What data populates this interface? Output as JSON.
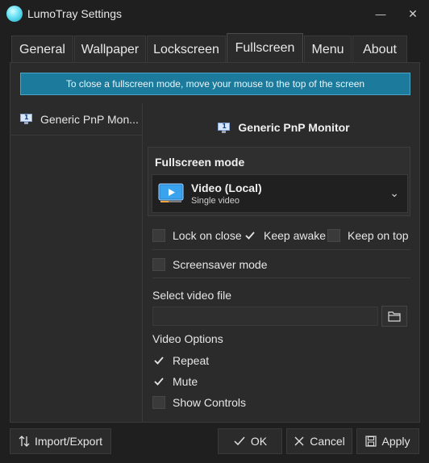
{
  "window": {
    "title": "LumoTray Settings",
    "minimize_glyph": "—",
    "close_glyph": "✕"
  },
  "tabs": [
    {
      "label": "General",
      "active": false
    },
    {
      "label": "Wallpaper",
      "active": false
    },
    {
      "label": "Lockscreen",
      "active": false
    },
    {
      "label": "Fullscreen",
      "active": true
    },
    {
      "label": "Menu",
      "active": false
    },
    {
      "label": "About",
      "active": false
    }
  ],
  "banner": {
    "text": "To close a fullscreen mode, move your mouse to the top of the screen",
    "color": "#1c7b9c"
  },
  "monitors": {
    "list_item": "Generic PnP Mon...",
    "icon_number": "1",
    "selected_header": "Generic PnP Monitor"
  },
  "fullscreen_mode": {
    "title": "Fullscreen mode",
    "selected_name": "Video (Local)",
    "selected_sub": "Single video",
    "chevron": "⌄"
  },
  "options": {
    "lock_on_close": {
      "label": "Lock on close",
      "checked": false
    },
    "keep_awake": {
      "label": "Keep awake",
      "checked": true
    },
    "keep_on_top": {
      "label": "Keep on top",
      "checked": false
    },
    "screensaver_mode": {
      "label": "Screensaver mode",
      "checked": false
    }
  },
  "video_file": {
    "label": "Select video file",
    "value": ""
  },
  "video_options": {
    "title": "Video Options",
    "repeat": {
      "label": "Repeat",
      "checked": true
    },
    "mute": {
      "label": "Mute",
      "checked": true
    },
    "show_controls": {
      "label": "Show Controls",
      "checked": false
    }
  },
  "footer": {
    "import_export": "Import/Export",
    "ok": "OK",
    "cancel": "Cancel",
    "apply": "Apply"
  }
}
